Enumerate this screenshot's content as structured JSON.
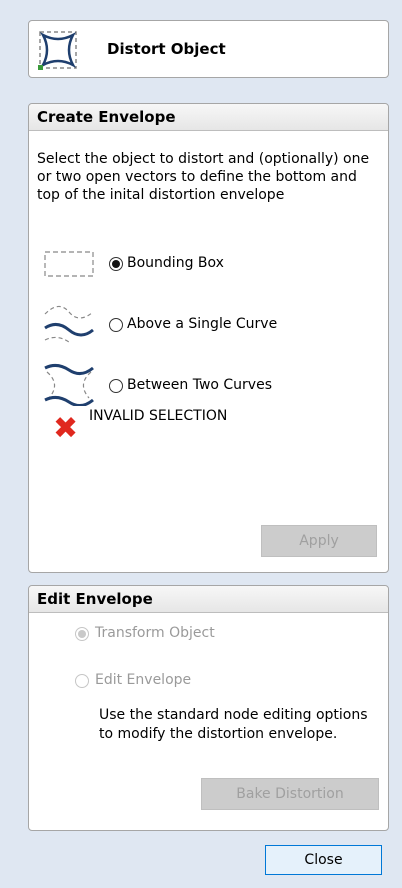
{
  "title": "Distort Object",
  "create_envelope": {
    "header": "Create Envelope",
    "description": "Select the object to distort and (optionally) one or two open vectors to define the bottom and top of the inital distortion envelope",
    "options": [
      {
        "label": "Bounding Box",
        "checked": true
      },
      {
        "label": "Above a Single Curve",
        "checked": false
      },
      {
        "label": "Between Two Curves",
        "checked": false
      }
    ],
    "status": "INVALID SELECTION",
    "apply_label": "Apply"
  },
  "edit_envelope": {
    "header": "Edit Envelope",
    "options": [
      {
        "label": "Transform Object",
        "checked": true,
        "enabled": false
      },
      {
        "label": "Edit Envelope",
        "checked": false,
        "enabled": false
      }
    ],
    "description": "Use the standard node editing options to modify the distortion envelope.",
    "bake_label": "Bake Distortion"
  },
  "close_label": "Close",
  "colors": {
    "error_red": "#e0281e",
    "accent_blue": "#0078d7"
  }
}
